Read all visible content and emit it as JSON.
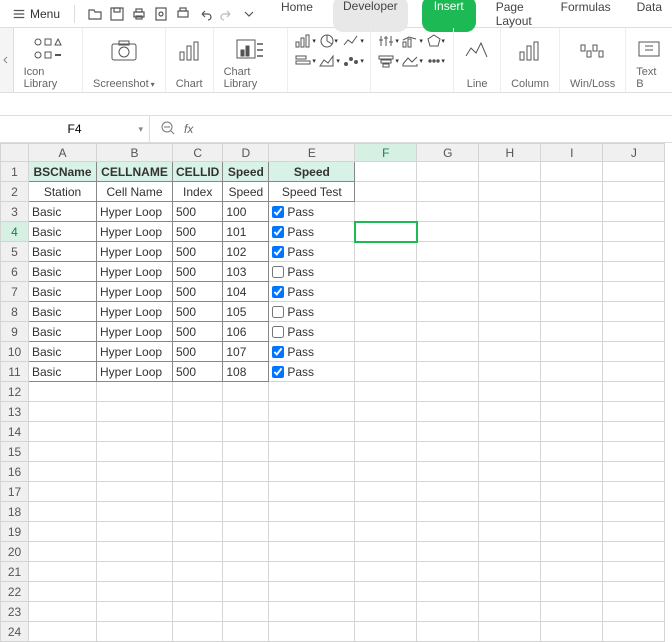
{
  "menu": {
    "label": "Menu"
  },
  "tabs": {
    "home": "Home",
    "developer": "Developer",
    "insert": "Insert",
    "page_layout": "Page Layout",
    "formulas": "Formulas",
    "data": "Data"
  },
  "ribbon": {
    "icon_library": "Icon Library",
    "screenshot": "Screenshot",
    "chart": "Chart",
    "chart_library": "Chart Library",
    "line": "Line",
    "column": "Column",
    "winloss": "Win/Loss",
    "textbox": "Text B"
  },
  "formula_bar": {
    "cell_ref": "F4",
    "fx": "fx",
    "value": ""
  },
  "columns": [
    "A",
    "B",
    "C",
    "D",
    "E",
    "F",
    "G",
    "H",
    "I",
    "J"
  ],
  "active_col": "F",
  "active_row": 4,
  "header1": [
    "BSCName",
    "CELLNAME",
    "CELLID",
    "Speed",
    "Speed"
  ],
  "header2": [
    "Station",
    "Cell Name",
    "Index",
    "Speed",
    "Speed Test"
  ],
  "rows": [
    {
      "a": "Basic",
      "b": "Hyper Loop",
      "c": "500",
      "d": "100",
      "chk": true,
      "e": "Pass"
    },
    {
      "a": "Basic",
      "b": "Hyper Loop",
      "c": "500",
      "d": "101",
      "chk": true,
      "e": "Pass"
    },
    {
      "a": "Basic",
      "b": "Hyper Loop",
      "c": "500",
      "d": "102",
      "chk": true,
      "e": "Pass"
    },
    {
      "a": "Basic",
      "b": "Hyper Loop",
      "c": "500",
      "d": "103",
      "chk": false,
      "e": "Pass"
    },
    {
      "a": "Basic",
      "b": "Hyper Loop",
      "c": "500",
      "d": "104",
      "chk": true,
      "e": "Pass"
    },
    {
      "a": "Basic",
      "b": "Hyper Loop",
      "c": "500",
      "d": "105",
      "chk": false,
      "e": "Pass"
    },
    {
      "a": "Basic",
      "b": "Hyper Loop",
      "c": "500",
      "d": "106",
      "chk": false,
      "e": "Pass"
    },
    {
      "a": "Basic",
      "b": "Hyper Loop",
      "c": "500",
      "d": "107",
      "chk": true,
      "e": "Pass"
    },
    {
      "a": "Basic",
      "b": "Hyper Loop",
      "c": "500",
      "d": "108",
      "chk": true,
      "e": "Pass"
    }
  ],
  "total_visible_rows": 24
}
